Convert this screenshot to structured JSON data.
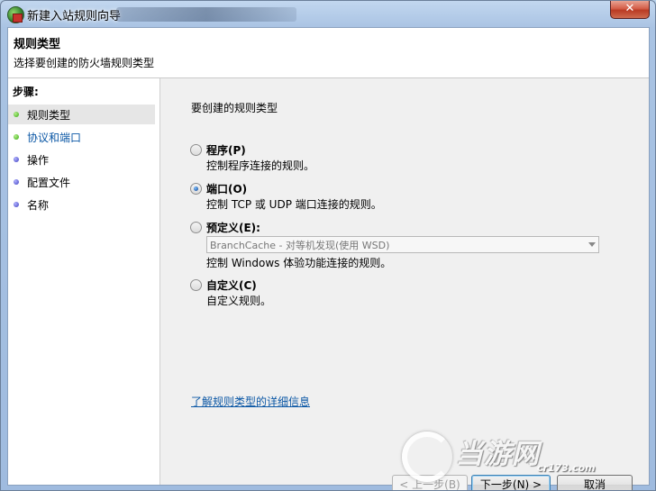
{
  "window": {
    "title": "新建入站规则向导",
    "close_label": "✕"
  },
  "header": {
    "title": "规则类型",
    "subtitle": "选择要创建的防火墙规则类型"
  },
  "steps": {
    "label": "步骤:",
    "items": [
      {
        "label": "规则类型",
        "status_color": "#36a80f"
      },
      {
        "label": "协议和端口",
        "status_color": "#36a80f"
      },
      {
        "label": "操作",
        "status_color": "#3d3fbf"
      },
      {
        "label": "配置文件",
        "status_color": "#3d3fbf"
      },
      {
        "label": "名称",
        "status_color": "#3d3fbf"
      }
    ]
  },
  "main": {
    "prompt": "要创建的规则类型",
    "options": [
      {
        "label": "程序(P)",
        "desc": "控制程序连接的规则。",
        "checked": false
      },
      {
        "label": "端口(O)",
        "desc": "控制 TCP 或 UDP 端口连接的规则。",
        "checked": true
      },
      {
        "label": "预定义(E):",
        "desc": "控制 Windows 体验功能连接的规则。",
        "checked": false
      },
      {
        "label": "自定义(C)",
        "desc": "自定义规则。",
        "checked": false
      }
    ],
    "predefined_select": {
      "value": "BranchCache - 对等机发现(使用 WSD)"
    },
    "learn_more_link": "了解规则类型的详细信息"
  },
  "buttons": {
    "back": "< 上一步(B)",
    "next": "下一步(N) >",
    "cancel": "取消"
  },
  "watermark": {
    "brand": "当游网",
    "domain": "cr173.com"
  }
}
